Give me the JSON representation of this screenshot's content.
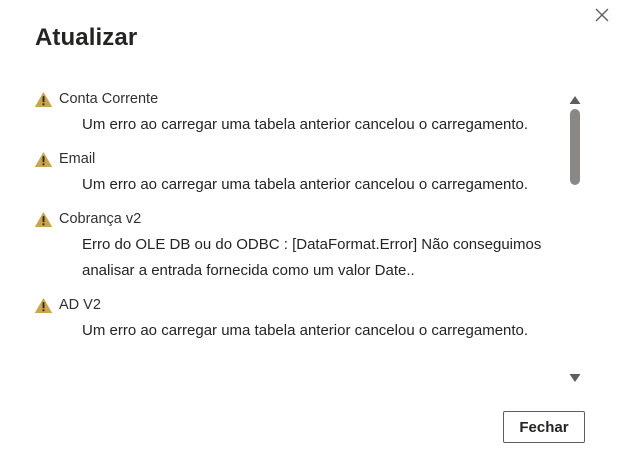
{
  "dialog": {
    "title": "Atualizar",
    "close_icon": "close-icon"
  },
  "items": [
    {
      "name": "Conta Corrente",
      "icon": "warning-icon",
      "message": "Um erro ao carregar uma tabela anterior cancelou o carregamento."
    },
    {
      "name": "Email",
      "icon": "warning-icon",
      "message": "Um erro ao carregar uma tabela anterior cancelou o carregamento."
    },
    {
      "name": "Cobrança v2",
      "icon": "warning-icon",
      "message": "Erro do OLE DB ou do ODBC : [DataFormat.Error] Não conseguimos analisar a entrada fornecida como um valor Date.."
    },
    {
      "name": "AD V2",
      "icon": "warning-icon",
      "message": "Um erro ao carregar uma tabela anterior cancelou o carregamento."
    }
  ],
  "footer": {
    "close_label": "Fechar"
  },
  "colors": {
    "warning_fill": "#c9a54b",
    "text": "#252423",
    "scroll_thumb": "#8a8886"
  }
}
